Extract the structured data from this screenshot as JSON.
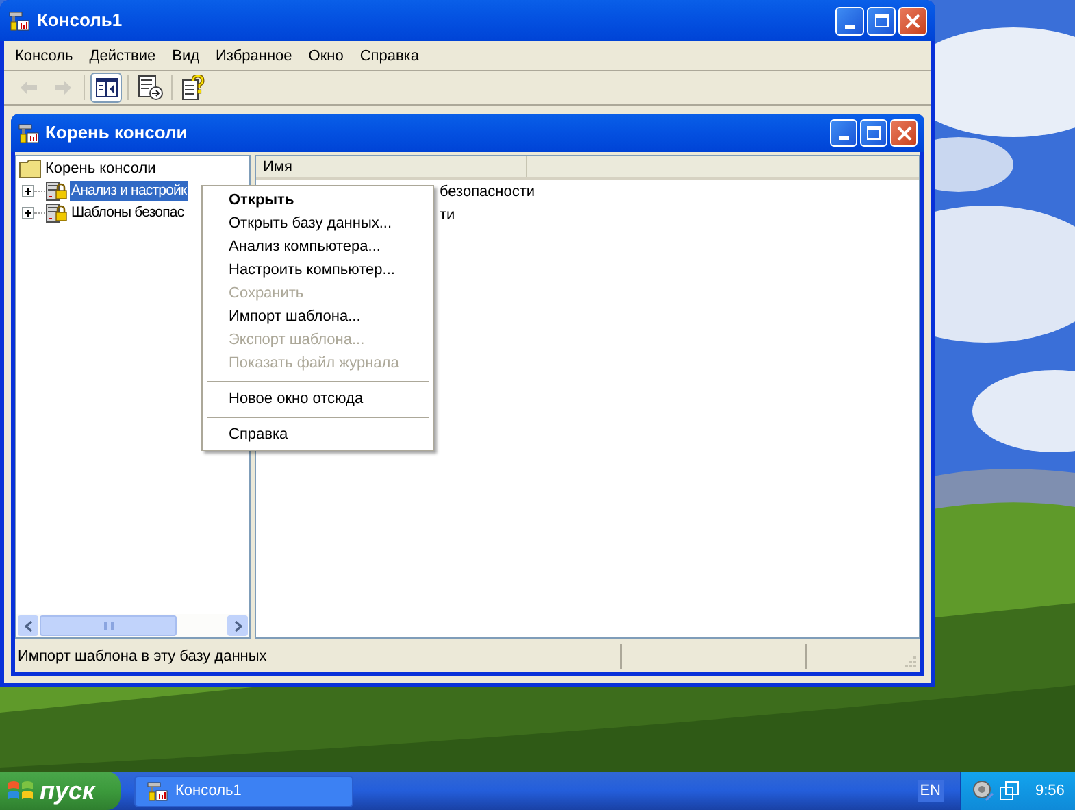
{
  "window": {
    "title": "Консоль1"
  },
  "menu_bar": [
    "Консоль",
    "Действие",
    "Вид",
    "Избранное",
    "Окно",
    "Справка"
  ],
  "toolbar": [
    {
      "kind": "back",
      "disabled": true,
      "pressed": false
    },
    {
      "kind": "forward",
      "disabled": true,
      "pressed": false
    },
    {
      "kind": "tree",
      "disabled": false,
      "pressed": true
    },
    {
      "kind": "export",
      "disabled": false,
      "pressed": false
    },
    {
      "kind": "help",
      "disabled": false,
      "pressed": false
    }
  ],
  "child_window": {
    "title": "Корень консоли",
    "tree": {
      "label": "Корень консоли",
      "children": [
        {
          "label": "Анализ и настройк",
          "selected": true,
          "expanded": false
        },
        {
          "label": "Шаблоны безопас",
          "selected": false,
          "expanded": false
        }
      ]
    },
    "list": {
      "columns": [
        "Имя"
      ],
      "rows": [
        "безопасности",
        "ти"
      ]
    },
    "status_bar": "Импорт шаблона в эту базу данных"
  },
  "context_menu": [
    {
      "kind": "item",
      "label": "Открыть",
      "default": true,
      "disabled": false
    },
    {
      "kind": "item",
      "label": "Открыть базу данных...",
      "default": false,
      "disabled": false
    },
    {
      "kind": "item",
      "label": "Анализ компьютера...",
      "default": false,
      "disabled": false
    },
    {
      "kind": "item",
      "label": "Настроить компьютер...",
      "default": false,
      "disabled": false
    },
    {
      "kind": "item",
      "label": "Сохранить",
      "default": false,
      "disabled": true
    },
    {
      "kind": "item",
      "label": "Импорт шаблона...",
      "default": false,
      "disabled": false
    },
    {
      "kind": "item",
      "label": "Экспорт шаблона...",
      "default": false,
      "disabled": true
    },
    {
      "kind": "item",
      "label": "Показать файл журнала",
      "default": false,
      "disabled": true
    },
    {
      "kind": "separator"
    },
    {
      "kind": "item",
      "label": "Новое окно отсюда",
      "default": false,
      "disabled": false
    },
    {
      "kind": "separator"
    },
    {
      "kind": "item",
      "label": "Справка",
      "default": false,
      "disabled": false
    }
  ],
  "taskbar": {
    "start": "пуск",
    "tasks": [
      {
        "label": "Консоль1",
        "selected": false
      }
    ],
    "language": "EN",
    "clock": "9:56"
  }
}
